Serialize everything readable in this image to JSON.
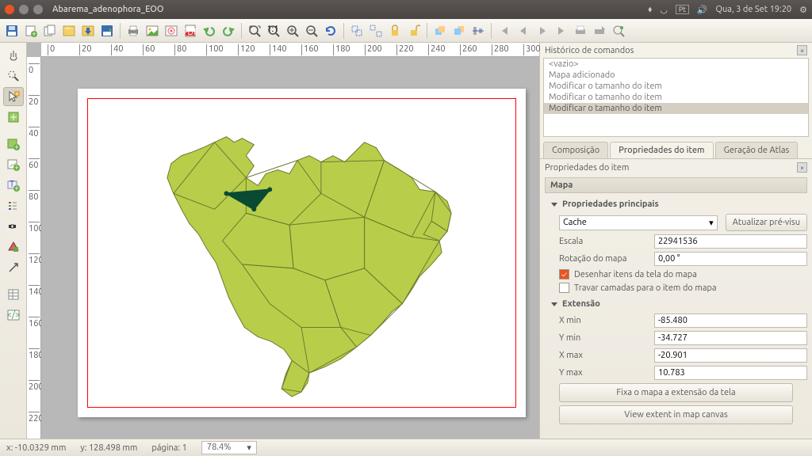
{
  "titlebar": {
    "title": "Abarema_adenophora_EOO",
    "clock": "Qua,  3 de Set 19:20",
    "kb": "Pt"
  },
  "history": {
    "title": "Histórico de comandos",
    "items": [
      "<vazio>",
      "Mapa adicionado",
      "Modificar o tamanho do item",
      "Modificar o tamanho do item",
      "Modificar o tamanho do item"
    ]
  },
  "tabs": {
    "comp": "Composição",
    "item": "Propriedades do item",
    "atlas": "Geração de Atlas"
  },
  "props": {
    "header": "Propriedades do item",
    "map_header": "Mapa",
    "main_section": "Propriedades principais",
    "cache": "Cache",
    "update": "Atualizar pré-visu",
    "escala_label": "Escala",
    "escala_val": "22941536",
    "rot_label": "Rotação do mapa",
    "rot_val": "0,00 °",
    "draw_items": "Desenhar itens da tela do mapa",
    "lock_layers": "Travar camadas para o item do mapa",
    "ext_section": "Extensão",
    "xmin_l": "X min",
    "xmin_v": "-85.480",
    "ymin_l": "Y min",
    "ymin_v": "-34.727",
    "xmax_l": "X max",
    "xmax_v": "-20.901",
    "ymax_l": "Y max",
    "ymax_v": "10.783",
    "fix_btn": "Fixa o mapa a extensão da tela",
    "view_btn": "View extent in map canvas"
  },
  "status": {
    "x": "x: -10.0329 mm",
    "y": "y: 128.498 mm",
    "page": "página: 1",
    "zoom": "78.4%"
  },
  "ruler_h": [
    "0",
    "20",
    "40",
    "60",
    "80",
    "100",
    "120",
    "140",
    "160",
    "180",
    "200",
    "220",
    "240",
    "260",
    "280",
    "300"
  ],
  "ruler_v": [
    "0",
    "20",
    "40",
    "60",
    "80",
    "100",
    "120",
    "140",
    "160",
    "180",
    "200",
    "220"
  ]
}
